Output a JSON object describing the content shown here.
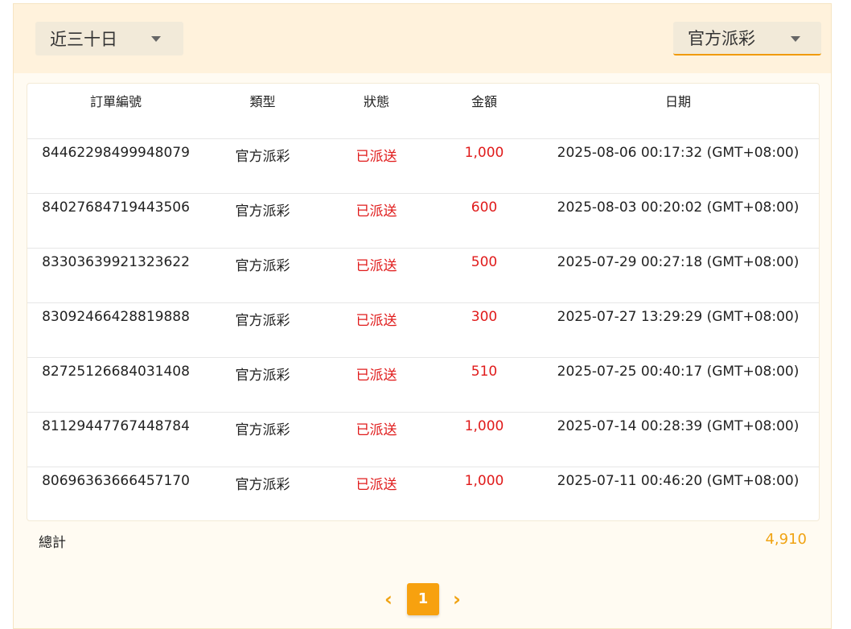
{
  "filters": {
    "range_label": "近三十日",
    "type_label": "官方派彩"
  },
  "table": {
    "headers": [
      "訂單編號",
      "類型",
      "狀態",
      "金額",
      "日期"
    ],
    "rows": [
      {
        "order": "84462298499948079",
        "type": "官方派彩",
        "status": "已派送",
        "amount": "1,000",
        "date": "2025-08-06 00:17:32 (GMT+08:00)"
      },
      {
        "order": "84027684719443506",
        "type": "官方派彩",
        "status": "已派送",
        "amount": "600",
        "date": "2025-08-03 00:20:02 (GMT+08:00)"
      },
      {
        "order": "83303639921323622",
        "type": "官方派彩",
        "status": "已派送",
        "amount": "500",
        "date": "2025-07-29 00:27:18 (GMT+08:00)"
      },
      {
        "order": "83092466428819888",
        "type": "官方派彩",
        "status": "已派送",
        "amount": "300",
        "date": "2025-07-27 13:29:29 (GMT+08:00)"
      },
      {
        "order": "82725126684031408",
        "type": "官方派彩",
        "status": "已派送",
        "amount": "510",
        "date": "2025-07-25 00:40:17 (GMT+08:00)"
      },
      {
        "order": "81129447767448784",
        "type": "官方派彩",
        "status": "已派送",
        "amount": "1,000",
        "date": "2025-07-14 00:28:39 (GMT+08:00)"
      },
      {
        "order": "80696363666457170",
        "type": "官方派彩",
        "status": "已派送",
        "amount": "1,000",
        "date": "2025-07-11 00:46:20 (GMT+08:00)"
      }
    ]
  },
  "summary": {
    "total_label": "總計",
    "total_value": "4,910"
  },
  "pagination": {
    "prev_icon": "chevron-left-icon",
    "next_icon": "chevron-right-icon",
    "current_page": "1"
  },
  "colors": {
    "accent": "#f0a313",
    "status_red": "#e01b1b",
    "header_bg": "#fff2dc"
  }
}
